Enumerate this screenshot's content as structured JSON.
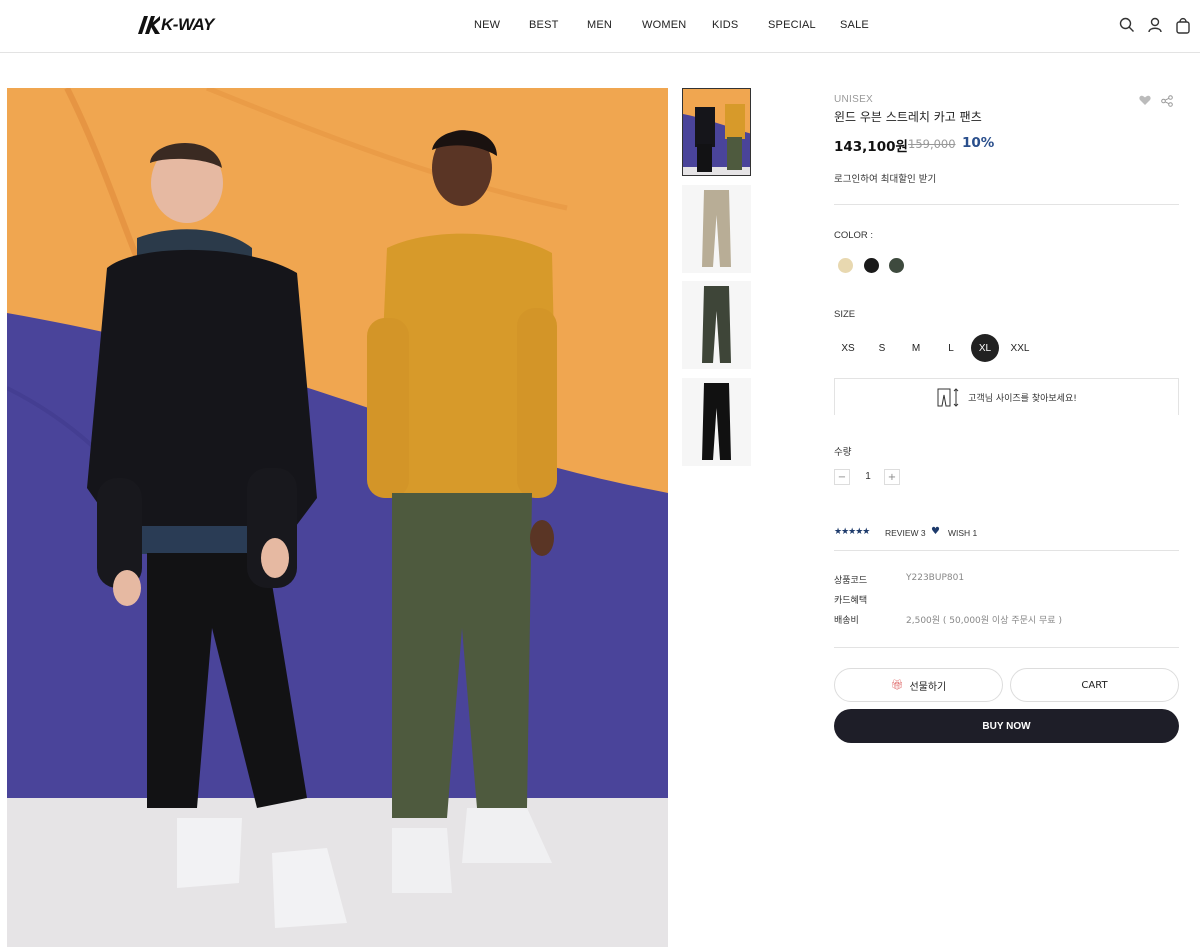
{
  "header": {
    "logo_text": "K-WAY",
    "nav": [
      {
        "label": "NEW"
      },
      {
        "label": "BEST"
      },
      {
        "label": "MEN"
      },
      {
        "label": "WOMEN"
      },
      {
        "label": "KIDS"
      },
      {
        "label": "SPECIAL"
      },
      {
        "label": "SALE"
      }
    ],
    "icons": [
      "search-icon",
      "user-icon",
      "shopping-bag-icon"
    ]
  },
  "product": {
    "brand_line": "UNISEX",
    "name": "윈드 우븐 스트레치 카고 팬츠",
    "price": "143,100원",
    "original_price": "159,000",
    "discount": "10%",
    "login_note": "로그인하여 최대할인 받기",
    "color_label": "COLOR :",
    "colors": [
      "#e8d8b0",
      "#1a1a1a",
      "#3e4a3e"
    ],
    "size_label": "SIZE",
    "sizes": [
      "XS",
      "S",
      "M",
      "L",
      "XL",
      "XXL"
    ],
    "selected_size": "XL",
    "size_guide": "고객님 사이즈를 찾아보세요!",
    "qty_label": "수량",
    "qty_minus": "−",
    "qty_plus": "+",
    "quantity": "1",
    "stars": "★★★★★",
    "review": "REVIEW 3",
    "wish": "WISH 1",
    "info": [
      {
        "key": "상품코드",
        "value": "Y223BUP801"
      },
      {
        "key": "카드혜택",
        "value": ""
      },
      {
        "key": "배송비",
        "value": "2,500원 ( 50,000원 이상 주문시 무료 )"
      }
    ],
    "gift_button": "선물하기",
    "cart_button": "CART",
    "buy_button": "BUY NOW"
  },
  "colors": {
    "accent": "#2a4f8c",
    "dark_button": "#1e1e28",
    "photo_orange": "#f0a650",
    "photo_purple": "#4a449a"
  }
}
